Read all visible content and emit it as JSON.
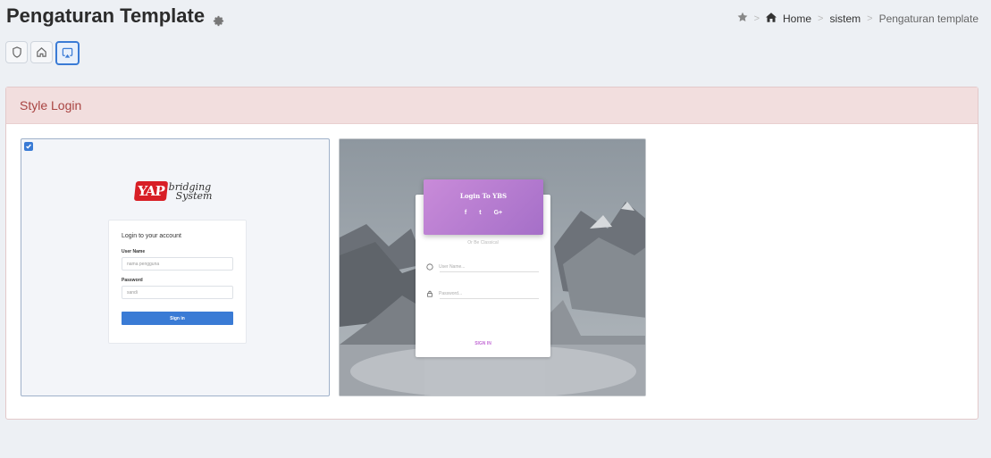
{
  "header": {
    "title": "Pengaturan Template"
  },
  "breadcrumb": {
    "home": "Home",
    "sistem": "sistem",
    "current": "Pengaturan template",
    "separator": ">"
  },
  "toolbar": {
    "buttons": [
      "shield-icon",
      "home-icon",
      "airplay-icon"
    ],
    "active": "airplay-icon"
  },
  "panel": {
    "title": "Style Login"
  },
  "templates": [
    {
      "selected": true,
      "logo_box": "YAP",
      "logo_line1": "bridging",
      "logo_line2": "System",
      "card_title": "Login to your account",
      "username_label": "User Name",
      "username_placeholder": "nama pengguna",
      "password_label": "Password",
      "password_placeholder": "sandi",
      "button": "Sign in"
    },
    {
      "selected": false,
      "header_title": "Login To YBS",
      "social": [
        "f",
        "t",
        "G+"
      ],
      "or_text": "Or Be Classical",
      "username_placeholder": "User Name...",
      "password_placeholder": "Password...",
      "button": "SIGN IN"
    }
  ],
  "colors": {
    "accent": "#3a7bd5",
    "panel_header_bg": "#f2dede",
    "panel_header_text": "#a94442",
    "card_gradient_start": "#c98bd9",
    "card_gradient_end": "#a56fc8"
  }
}
